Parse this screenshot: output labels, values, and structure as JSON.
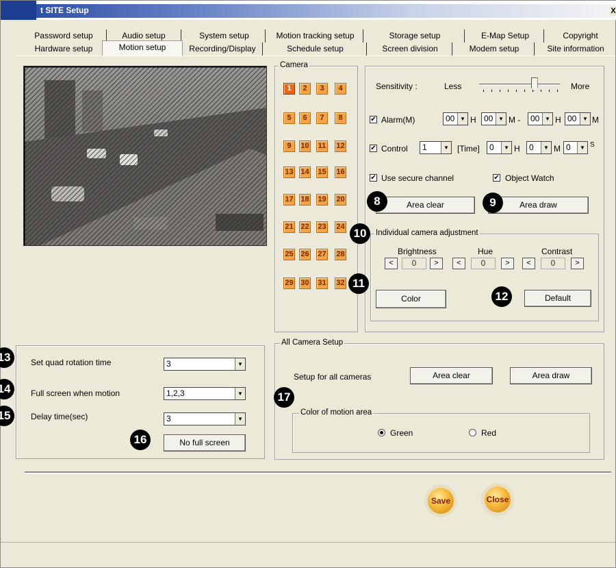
{
  "window": {
    "title": "t SITE Setup",
    "close_glyph": "X"
  },
  "tabs_row1": [
    "Password setup",
    "Audio setup",
    "System setup",
    "Motion tracking setup",
    "Storage setup",
    "E-Map Setup",
    "Copyright"
  ],
  "tabs_row2": [
    "Hardware setup",
    "Motion setup",
    "Recording/Display",
    "Schedule setup",
    "Screen division",
    "Modem setup",
    "Site information"
  ],
  "active_tab": "Motion setup",
  "camera_group": {
    "legend": "Camera",
    "cameras": [
      "1",
      "2",
      "3",
      "4",
      "5",
      "6",
      "7",
      "8",
      "9",
      "10",
      "11",
      "12",
      "13",
      "14",
      "15",
      "16",
      "17",
      "18",
      "19",
      "20",
      "21",
      "22",
      "23",
      "24",
      "25",
      "26",
      "27",
      "28",
      "29",
      "30",
      "31",
      "32"
    ],
    "selected": "1"
  },
  "motion": {
    "sensitivity_label": "Sensitivity :",
    "less": "Less",
    "more": "More",
    "sensitivity_level": 0.72,
    "alarm_label": "Alarm(M)",
    "alarm_checked": true,
    "alarm_values": [
      "00",
      "00",
      "00",
      "00"
    ],
    "unit_h": "H",
    "unit_m_dash": "M -",
    "unit_m": "M",
    "control_label": "Control",
    "control_checked": true,
    "control_value": "1",
    "time_label": "[Time]",
    "time_values": [
      "0",
      "0",
      "0"
    ],
    "unit_s": "S",
    "secure_label": "Use secure channel",
    "secure_checked": true,
    "object_watch_label": "Object Watch",
    "object_watch_checked": true,
    "area_clear": "Area clear",
    "area_draw": "Area draw"
  },
  "adjust": {
    "legend": "Individual camera adjustment",
    "brightness": "Brightness",
    "hue": "Hue",
    "contrast": "Contrast",
    "brightness_val": "0",
    "hue_val": "0",
    "contrast_val": "0",
    "left": "<",
    "right": ">",
    "color_btn": "Color",
    "default_btn": "Default"
  },
  "quad": {
    "rotation_label": "Set quad rotation time",
    "rotation_value": "3",
    "fullscreen_label": "Full screen when motion",
    "fullscreen_value": "1,2,3",
    "delay_label": "Delay time(sec)",
    "delay_value": "3",
    "no_full_screen": "No full screen"
  },
  "all_camera": {
    "legend": "All Camera Setup",
    "setup_label": "Setup for all cameras",
    "area_clear": "Area clear",
    "area_draw": "Area draw",
    "color_legend": "Color of motion area",
    "green": "Green",
    "red": "Red",
    "selected": "Green"
  },
  "markers": [
    "8",
    "9",
    "10",
    "11",
    "12",
    "13",
    "14",
    "15",
    "16",
    "17"
  ],
  "footer": {
    "save": "Save",
    "close": "Close"
  }
}
